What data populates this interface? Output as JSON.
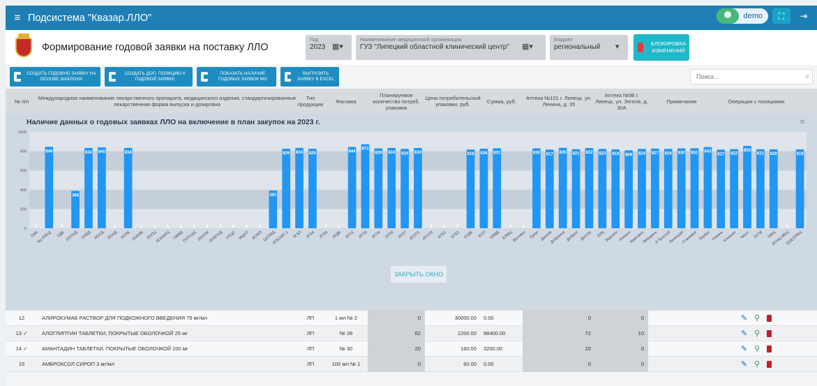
{
  "app": {
    "title": "Подсистема \"Квазар.ЛЛО\"",
    "user": "demo"
  },
  "header": {
    "title": "Формирование годовой заявки на поставку ЛЛО",
    "year_label": "Год",
    "year_value": "2023",
    "org_label": "Наименование медицинской организации",
    "org_value": "ГУЗ \"Липецкий областной клинический центр\"",
    "budget_label": "Бюджет",
    "budget_value": "региональный",
    "lock_label": "БЛОКИРОВКА ИЗМЕНЕНИЙ"
  },
  "actions": {
    "create_template": "СОЗДАТЬ ГОДОВУЮ ЗАЯВКУ НА ОСНОВЕ ШАБЛОНА",
    "add_position": "СОЗДАТЬ ДОП. ПОЗИЦИЮ К ГОДОВОЙ ЗАЯВКЕ",
    "show_mo": "ПОКАЗАТЬ НАЛИЧИЕ ГОДОВЫХ ЗАЯВОК МО",
    "export_excel": "ВЫГРУЗИТЬ ЗАЯВКУ В EXCEL",
    "search_placeholder": "Поиск..."
  },
  "table": {
    "headers": {
      "num": "№ п/п",
      "name": "Международное наименование лекарственного препарата, медицинского изделия, стандартизированные лекарственная форма выпуска и дозировка",
      "type": "Тип продукции",
      "pack": "Фасовка",
      "qty": "Планируемое количество потреб. упаковок",
      "price": "Цена потребительской упаковки, руб.",
      "sum": "Сумма, руб.",
      "apt1": "Аптека №101 г. Липецк, ул. Ленина, д. 35",
      "apt2": "Аптека №98 г. Липецк, ул. Зегеля, д. 30А",
      "note": "Примечание",
      "ops": "Операции с позициями"
    },
    "rows": [
      {
        "num": "12",
        "name": "АЛИРОКУМАБ РАСТВОР ДЛЯ ПОДКОЖНОГО ВВЕДЕНИЯ 75 мг/мл",
        "type": "ЛП",
        "pack": "1 мл № 2",
        "qty": "0",
        "price": "30000.00",
        "sum": "0.00",
        "apt1": "0",
        "apt2": "0"
      },
      {
        "num": "13 ✓",
        "name": "АЛОГЛИПТИН ТАБЛЕТКИ, ПОКРЫТЫЕ ОБОЛОЧКОЙ 25 мг",
        "type": "ЛП",
        "pack": "№ 28",
        "qty": "82",
        "price": "1200.00",
        "sum": "98400.00",
        "apt1": "72",
        "apt2": "10"
      },
      {
        "num": "14 ✓",
        "name": "АМАНТАДИН ТАБЛЕТКИ, ПОКРЫТЫЕ ОБОЛОЧКОЙ 100 мг",
        "type": "ЛП",
        "pack": "№ 30",
        "qty": "20",
        "price": "160.00",
        "sum": "3200.00",
        "apt1": "20",
        "apt2": "0"
      },
      {
        "num": "15",
        "name": "АМБРОКСОЛ СИРОП 3 мг/мл",
        "type": "ЛП",
        "pack": "100 мл № 1",
        "qty": "0",
        "price": "60.00",
        "sum": "0.00",
        "apt1": "0",
        "apt2": "0"
      }
    ]
  },
  "modal": {
    "close_label": "ЗАКРЫТЬ ОКНО"
  },
  "chart_data": {
    "type": "bar",
    "title": "Наличие данных о годовых заявках ЛЛО на включение в план закупок на 2023 г.",
    "ylim": [
      0,
      1000
    ],
    "yticks": [
      0,
      200,
      400,
      600,
      800,
      1000
    ],
    "color": "#2196f3",
    "categories": [
      "ОКБ",
      "ЧЦ (ОБЦ)",
      "ОДБ",
      "ЛОПНД",
      "ОКВД",
      "ЛООД",
      "ЛОНД",
      "ЛОПБ",
      "ЛОКИБ",
      "ЛОПЦ",
      "ЛОКМЛЦ",
      "ОВФД",
      "ОСП-ЦЦ",
      "ЛОСПК",
      "ЛОКПНД",
      "УПЦС",
      "МЦНТ",
      "БСМЭ",
      "ЦСПИД",
      "ЛГБСМП 1",
      "ЛГБ3",
      "ЛГБ4",
      "ЛГБ6",
      "ЛГДБ",
      "ЛГП1",
      "ЛГП2",
      "ЛГП4",
      "ЛГП5",
      "ЛГП7",
      "ЛГСП1",
      "ЛГСП2",
      "ЕГБ1",
      "ЕГБ2",
      "ЕГДБ",
      "ЕСП",
      "ЕВВД",
      "ЕЛМЦ",
      "Воловск",
      "Грязи",
      "Данков",
      "Добринка",
      "Доброе",
      "Долгор",
      "ЕРБ",
      "Задонск",
      "Измалк",
      "Краснинс",
      "Лебедянь",
      "Л-Толстой",
      "Липецкая",
      "Становое",
      "Тербун",
      "Усмань",
      "Хлевное",
      "Чаплг",
      "ЛГП8",
      "НМЦ",
      "ЛОЧЦ МБЦ",
      "ЦУД ЕРБЦ"
    ],
    "values": [
      0,
      846,
      0,
      388,
      834,
      840,
      0,
      834,
      0,
      0,
      0,
      0,
      0,
      0,
      0,
      0,
      0,
      0,
      391,
      826,
      834,
      825,
      0,
      0,
      844,
      872,
      829,
      834,
      824,
      833,
      0,
      0,
      0,
      818,
      826,
      831,
      0,
      0,
      830,
      817,
      835,
      821,
      832,
      823,
      819,
      809,
      824,
      827,
      824,
      830,
      831,
      843,
      817,
      822,
      855,
      821,
      820,
      0,
      819,
      0,
      814
    ],
    "labels_shown": true
  }
}
